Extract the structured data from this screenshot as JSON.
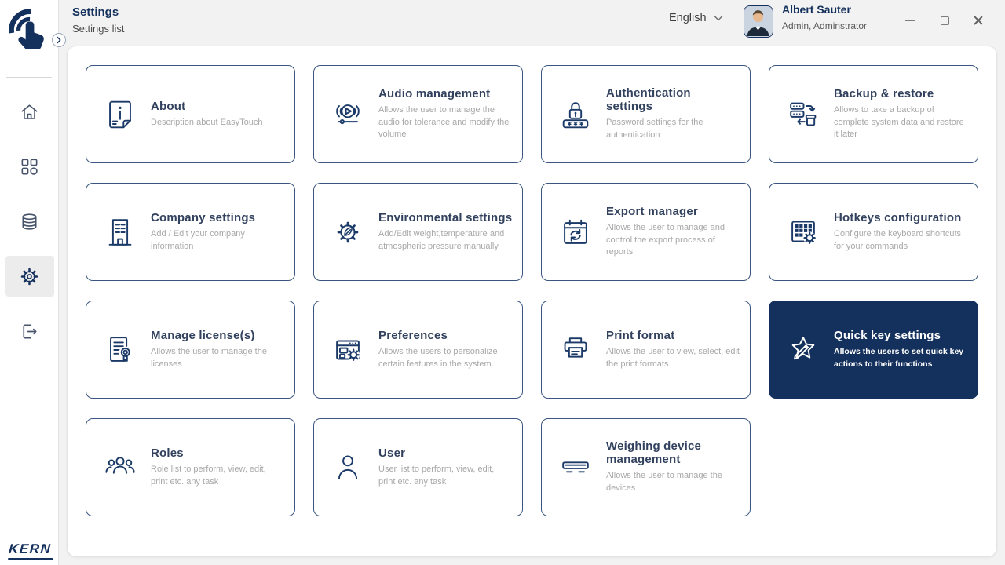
{
  "colors": {
    "brand_navy": "#14305C",
    "card_border": "#3A5680",
    "highlight_card_bg": "#14305C",
    "description_gray": "#A8A8A8",
    "page_background": "#F2F2F2"
  },
  "header": {
    "title": "Settings",
    "subtitle": "Settings list",
    "language": {
      "selected": "English",
      "chevron_icon": "chevron-down-icon"
    },
    "user": {
      "name": "Albert Sauter",
      "role": "Admin, Adminstrator"
    },
    "window_controls": [
      {
        "name": "minimize",
        "icon": "minimize-icon"
      },
      {
        "name": "maximize",
        "icon": "maximize-icon"
      },
      {
        "name": "close",
        "icon": "close-icon"
      }
    ]
  },
  "sidebar": {
    "brand": "KERN",
    "expand_icon": "chevron-right-icon",
    "items": [
      {
        "name": "home",
        "icon": "home-icon",
        "active": false
      },
      {
        "name": "apps",
        "icon": "apps-icon",
        "active": false
      },
      {
        "name": "database",
        "icon": "database-icon",
        "active": false
      },
      {
        "name": "settings",
        "icon": "gear-icon",
        "active": true
      },
      {
        "name": "logout",
        "icon": "logout-icon",
        "active": false
      }
    ]
  },
  "cards": [
    {
      "slug": "about",
      "title": "About",
      "description": "Description about EasyTouch",
      "icon": "about-icon",
      "highlighted": false
    },
    {
      "slug": "audio-management",
      "title": "Audio management",
      "description": "Allows the user to manage the audio for tolerance and modify the volume",
      "icon": "audio-icon",
      "highlighted": false
    },
    {
      "slug": "authentication-settings",
      "title": "Authentication settings",
      "description": "Password settings for the authentication",
      "icon": "auth-lock-icon",
      "highlighted": false
    },
    {
      "slug": "backup-restore",
      "title": "Backup & restore",
      "description": "Allows to take a backup of complete system data and restore it later",
      "icon": "backup-restore-icon",
      "highlighted": false
    },
    {
      "slug": "company-settings",
      "title": "Company settings",
      "description": "Add / Edit your company information",
      "icon": "company-building-icon",
      "highlighted": false
    },
    {
      "slug": "environmental-settings",
      "title": "Environmental settings",
      "description": "Add/Edit weight,temperature and atmospheric pressure manually",
      "icon": "environment-gear-leaf-icon",
      "highlighted": false
    },
    {
      "slug": "export-manager",
      "title": "Export manager",
      "description": "Allows the user to manage and control the export process of reports",
      "icon": "export-calendar-icon",
      "highlighted": false
    },
    {
      "slug": "hotkeys-configuration",
      "title": "Hotkeys configuration",
      "description": "Configure the keyboard shortcuts for your commands",
      "icon": "hotkeys-keypad-icon",
      "highlighted": false
    },
    {
      "slug": "manage-licenses",
      "title": "Manage license(s)",
      "description": "Allows the user to manage the licenses",
      "icon": "license-document-icon",
      "highlighted": false
    },
    {
      "slug": "preferences",
      "title": "Preferences",
      "description": "Allows the users to personalize certain features in the system",
      "icon": "preferences-window-icon",
      "highlighted": false
    },
    {
      "slug": "print-format",
      "title": "Print format",
      "description": "Allows the user to view, select, edit the print formats",
      "icon": "print-format-icon",
      "highlighted": false
    },
    {
      "slug": "quick-key-settings",
      "title": "Quick key settings",
      "description": "Allows the users to set quick key actions to their functions",
      "icon": "quick-key-star-icon",
      "highlighted": true
    },
    {
      "slug": "roles",
      "title": "Roles",
      "description": "Role list to perform, view, edit, print etc. any task",
      "icon": "roles-group-icon",
      "highlighted": false
    },
    {
      "slug": "user",
      "title": "User",
      "description": "User list to perform, view, edit, print etc. any task",
      "icon": "user-person-icon",
      "highlighted": false
    },
    {
      "slug": "weighing-device-management",
      "title": "Weighing device management",
      "description": "Allows the user to manage the devices",
      "icon": "weighing-device-icon",
      "highlighted": false
    }
  ]
}
